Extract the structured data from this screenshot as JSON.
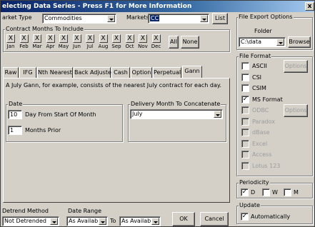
{
  "window": {
    "title": "electing Data Series - Press F1 for More Information",
    "close_glyph": "x"
  },
  "top": {
    "market_type_label": "arket Type",
    "market_type_value": "Commodities",
    "markets_label": "Markets",
    "markets_value": "CC",
    "list_button": "List"
  },
  "contract_months": {
    "group_label": "Contract Months To Include",
    "check_glyph": "X",
    "months": [
      "Jan",
      "Feb",
      "Mar",
      "Apr",
      "May",
      "Jun",
      "Jul",
      "Aug",
      "Sep",
      "Oct",
      "Nov",
      "Dec"
    ],
    "all_button": "All",
    "none_button": "None"
  },
  "tabs": [
    "Raw",
    "IFG",
    "Nth Nearest",
    "Back Adjusted",
    "Cash",
    "Option",
    "Perpetual",
    "Gann"
  ],
  "active_tab": "Gann",
  "gann": {
    "description": "A July Gann, for example, consists of the nearest July contract for each day.",
    "date_group_label": "Date",
    "day_value": "10",
    "day_label": "Day From Start Of Month",
    "months_value": "1",
    "months_label": "Months Prior",
    "delivery_group_label": "Delivery Month To Concatenate",
    "delivery_value": "July"
  },
  "bottom": {
    "detrend_label": "Detrend Method",
    "detrend_value": "Not Detrended",
    "date_range_label": "Date Range",
    "from_value": "As Available",
    "to_label": "To",
    "to_value": "As Available",
    "ok_button": "OK",
    "cancel_button": "Cancel"
  },
  "file_export": {
    "group_label": "File Export Options",
    "folder_label": "Folder",
    "folder_value": "C:\\data",
    "browse_button": "Browse"
  },
  "file_format": {
    "group_label": "File Format",
    "options": [
      {
        "label": "ASCII",
        "checked": "",
        "enabled": true
      },
      {
        "label": "CSI",
        "checked": "",
        "enabled": true
      },
      {
        "label": "CSIM",
        "checked": "",
        "enabled": true
      },
      {
        "label": "MS Format",
        "checked": "✓",
        "enabled": true
      },
      {
        "label": "ODBC",
        "checked": "",
        "enabled": false
      },
      {
        "label": "Paradox",
        "checked": "",
        "enabled": false
      },
      {
        "label": "dBase",
        "checked": "",
        "enabled": false
      },
      {
        "label": "Excel",
        "checked": "",
        "enabled": false
      },
      {
        "label": "Access",
        "checked": "",
        "enabled": false
      },
      {
        "label": "Lotus 123",
        "checked": "",
        "enabled": false
      }
    ],
    "options_button_1": "Options",
    "options_button_2": "Options"
  },
  "periodicity": {
    "group_label": "Periodicity",
    "d_label": "D",
    "d_checked": "✓",
    "w_label": "W",
    "w_checked": "",
    "m_label": "M",
    "m_checked": ""
  },
  "update": {
    "group_label": "Update",
    "auto_label": "Automatically",
    "auto_checked": "✓"
  }
}
